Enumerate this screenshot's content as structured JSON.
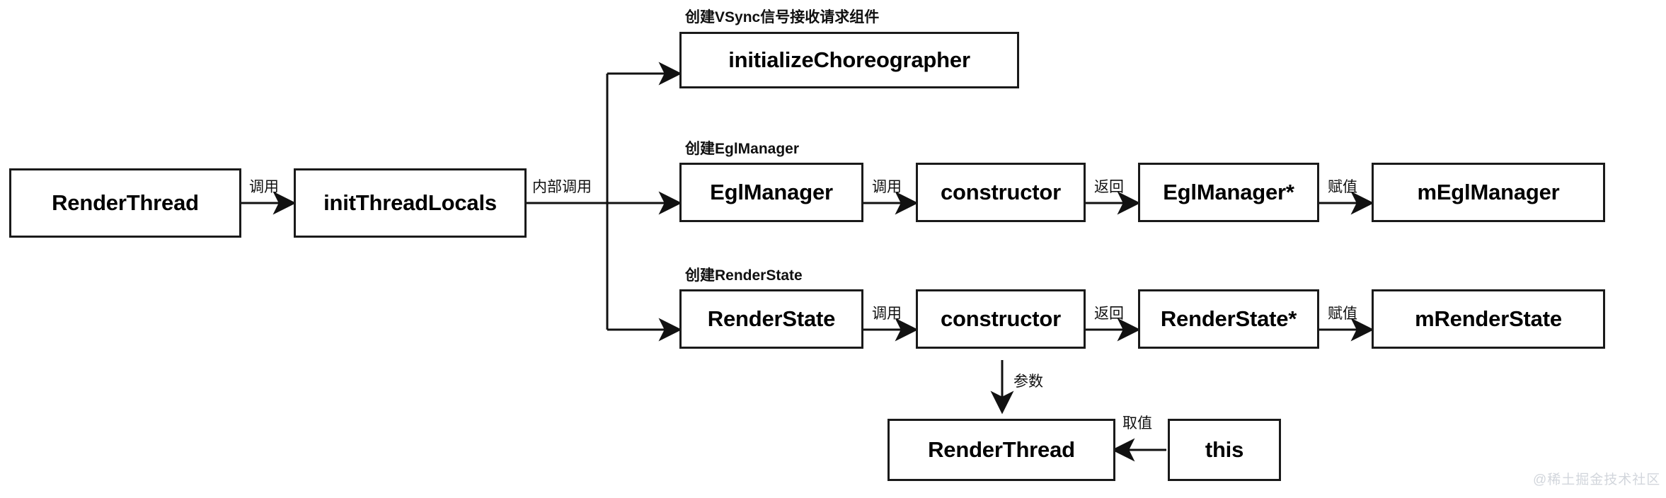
{
  "diagram": {
    "title": "RenderThread initThreadLocals flow",
    "background": "#ffffff",
    "stroke": "#1a1a1a",
    "text_color": "#000000",
    "nodes": [
      {
        "id": "render_thread",
        "label": "RenderThread"
      },
      {
        "id": "init_thread_locals",
        "label": "initThreadLocals"
      },
      {
        "id": "initialize_choreographer",
        "label": "initializeChoreographer"
      },
      {
        "id": "egl_manager",
        "label": "EglManager"
      },
      {
        "id": "egl_constructor",
        "label": "constructor"
      },
      {
        "id": "egl_manager_ptr",
        "label": "EglManager*"
      },
      {
        "id": "m_egl_manager",
        "label": "mEglManager"
      },
      {
        "id": "render_state",
        "label": "RenderState"
      },
      {
        "id": "rs_constructor",
        "label": "constructor"
      },
      {
        "id": "render_state_ptr",
        "label": "RenderState*"
      },
      {
        "id": "m_render_state",
        "label": "mRenderState"
      },
      {
        "id": "render_thread_param",
        "label": "RenderThread"
      },
      {
        "id": "this_node",
        "label": "this"
      }
    ],
    "captions": [
      {
        "id": "cap_choreographer",
        "text": "创建VSync信号接收请求组件"
      },
      {
        "id": "cap_egl_manager",
        "text": "创建EglManager"
      },
      {
        "id": "cap_render_state",
        "text": "创建RenderState"
      }
    ],
    "edge_labels": [
      {
        "id": "edge_call_init",
        "text": "调用"
      },
      {
        "id": "edge_internal_call",
        "text": "内部调用"
      },
      {
        "id": "edge_egl_call",
        "text": "调用"
      },
      {
        "id": "edge_egl_return",
        "text": "返回"
      },
      {
        "id": "edge_egl_assign",
        "text": "赋值"
      },
      {
        "id": "edge_rs_call",
        "text": "调用"
      },
      {
        "id": "edge_rs_return",
        "text": "返回"
      },
      {
        "id": "edge_rs_assign",
        "text": "赋值"
      },
      {
        "id": "edge_param",
        "text": "参数"
      },
      {
        "id": "edge_getvalue",
        "text": "取值"
      }
    ],
    "watermark": {
      "text": "@稀土掘金技术社区"
    }
  }
}
